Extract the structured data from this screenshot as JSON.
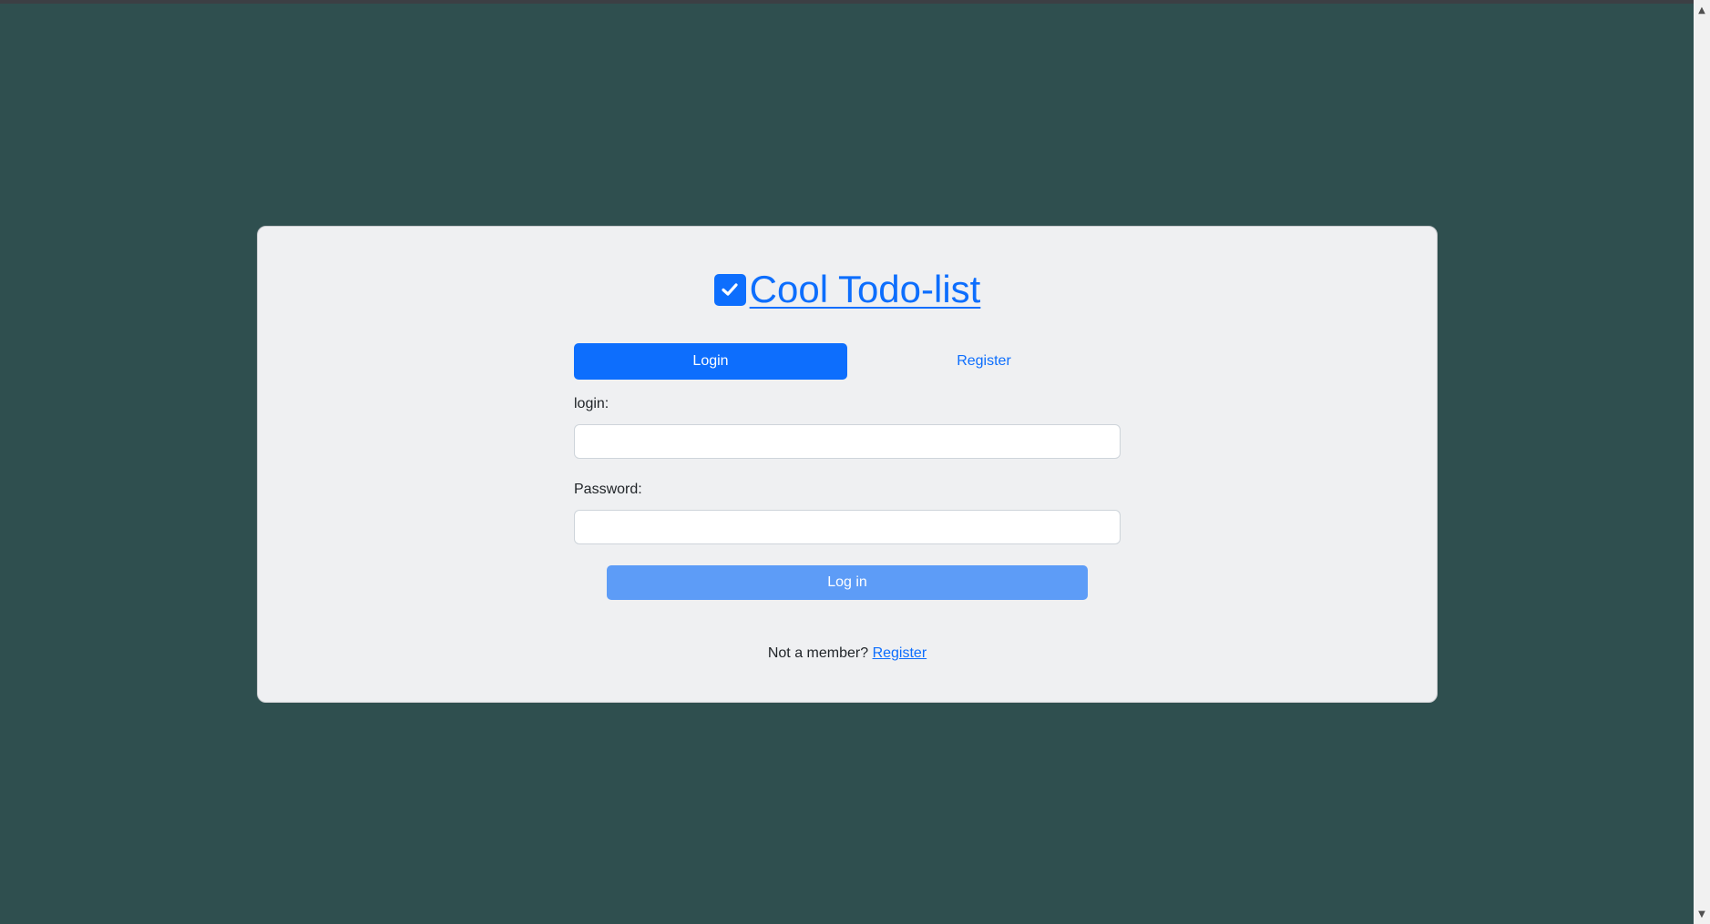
{
  "app": {
    "title": "Cool Todo-list",
    "brand_icon": "check-square-icon"
  },
  "tabs": [
    {
      "label": "Login",
      "active": true
    },
    {
      "label": "Register",
      "active": false
    }
  ],
  "form": {
    "login_label": "login:",
    "login_value": "",
    "password_label": "Password:",
    "password_value": "",
    "submit_label": "Log in"
  },
  "footer": {
    "prompt": "Not a member?",
    "link": "Register"
  },
  "colors": {
    "background": "#2f4f4f",
    "card": "#eff0f2",
    "primary": "#0d6efd",
    "submit_disabled": "#5d9cf7"
  }
}
